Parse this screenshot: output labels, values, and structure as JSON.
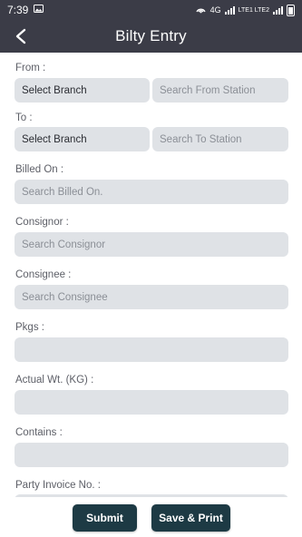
{
  "status_bar": {
    "time": "7:39",
    "network": "4G",
    "network_detail": "LTE1 LTE2"
  },
  "app_bar": {
    "title": "Bilty Entry"
  },
  "form": {
    "from": {
      "label": "From :",
      "branch_value": "Select Branch",
      "station_placeholder": "Search From Station"
    },
    "to": {
      "label": "To :",
      "branch_value": "Select Branch",
      "station_placeholder": "Search To Station"
    },
    "billed_on": {
      "label": "Billed On :",
      "placeholder": "Search Billed On."
    },
    "consignor": {
      "label": "Consignor :",
      "placeholder": "Search Consignor"
    },
    "consignee": {
      "label": "Consignee :",
      "placeholder": "Search Consignee"
    },
    "pkgs": {
      "label": "Pkgs :",
      "placeholder": ""
    },
    "actual_wt": {
      "label": "Actual Wt. (KG) :",
      "placeholder": ""
    },
    "contains": {
      "label": "Contains :",
      "placeholder": ""
    },
    "party_invoice": {
      "label": "Party Invoice No. :",
      "placeholder": ""
    }
  },
  "actions": {
    "submit_label": "Submit",
    "save_print_label": "Save & Print"
  },
  "colors": {
    "app_bar": "#3b3c47",
    "field_bg": "#dfe2e6",
    "button_bg": "#1d3a44"
  }
}
